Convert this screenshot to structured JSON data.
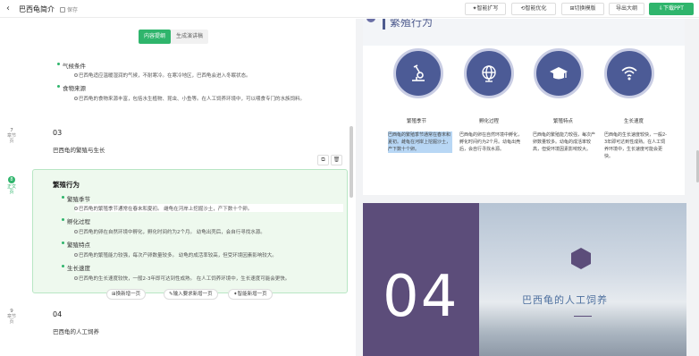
{
  "header": {
    "back_icon": "chevron-left-icon",
    "title": "巴西龟简介",
    "save_label": "保存",
    "buttons": [
      "✦智能扩写",
      "⟲智能优化",
      "⊞切换模版",
      "导出大纲",
      "⇩下载PPT"
    ],
    "accent": "#2fb56c"
  },
  "editor": {
    "tabs": [
      "内容提纲",
      "生成演讲稿"
    ],
    "active_tab": 0,
    "prev_section": {
      "items": [
        {
          "label": "气候条件",
          "detail": "巴西龟适应温暖湿润的气候，不耐寒冷。在寒冷地区，巴西龟会进入冬眠状态。"
        },
        {
          "label": "食物来源",
          "detail": "巴西龟的食物来源丰富，包括水生植物、昆虫、小鱼等。在人工饲养环境中，可以喂食专门的水族饲料。"
        }
      ]
    },
    "page7": {
      "num": "7",
      "type": "章节页",
      "section_no": "03",
      "section_title": "巴西龟的繁殖与生长"
    },
    "page8": {
      "num": "8",
      "type": "正文页",
      "title": "繁殖行为",
      "items": [
        {
          "label": "繁殖季节",
          "detail": "巴西龟的繁殖季节通常在春末和夏初。 雌龟在河岸上挖掘沙土，产下数十个卵。"
        },
        {
          "label": "孵化过程",
          "detail": "巴西龟的卵在自然环境中孵化，孵化时间约为2个月。 幼龟出壳后，会自行寻找水源。"
        },
        {
          "label": "繁殖特点",
          "detail": "巴西龟的繁殖能力较强，每次产卵数量较多。 幼龟的成活率较高，但受环境因素影响较大。"
        },
        {
          "label": "生长速度",
          "detail": "巴西龟的生长速度较快，一般2-3年即可达到性成熟。 在人工饲养环境中，生长速度可能会更快。"
        }
      ],
      "actions": [
        "⊞换新增一页",
        "✎输入要求新增一页",
        "✦智能新增一页"
      ]
    },
    "page9": {
      "num": "9",
      "type": "章节页",
      "section_no": "04",
      "section_title": "巴西龟的人工饲养"
    }
  },
  "preview": {
    "slide1": {
      "title": "繁殖行为",
      "labels": [
        "繁殖季节",
        "孵化过程",
        "繁殖特点",
        "生长速度"
      ],
      "descs": [
        "巴西龟的繁殖季节通常在春末和夏初。雌龟在河岸上挖掘沙土，产下数十个卵。",
        "巴西龟的卵在自然环境中孵化，孵化时间约为2个月。幼龟出壳后，会自行寻找水源。",
        "巴西龟的繁殖能力较强，每次产卵数量较多。幼龟的成活率较高，但受环境因素影响较大。",
        "巴西龟的生长速度较快，一般2-3年即可达到性成熟。在人工饲养环境中，生长速度可能会更快。"
      ],
      "icons": [
        "microscope-icon",
        "globe-icon",
        "graduation-cap-icon",
        "wifi-icon"
      ]
    },
    "slide2": {
      "number": "04",
      "title": "巴西龟的人工饲养",
      "icon": "infinity-icon"
    }
  }
}
